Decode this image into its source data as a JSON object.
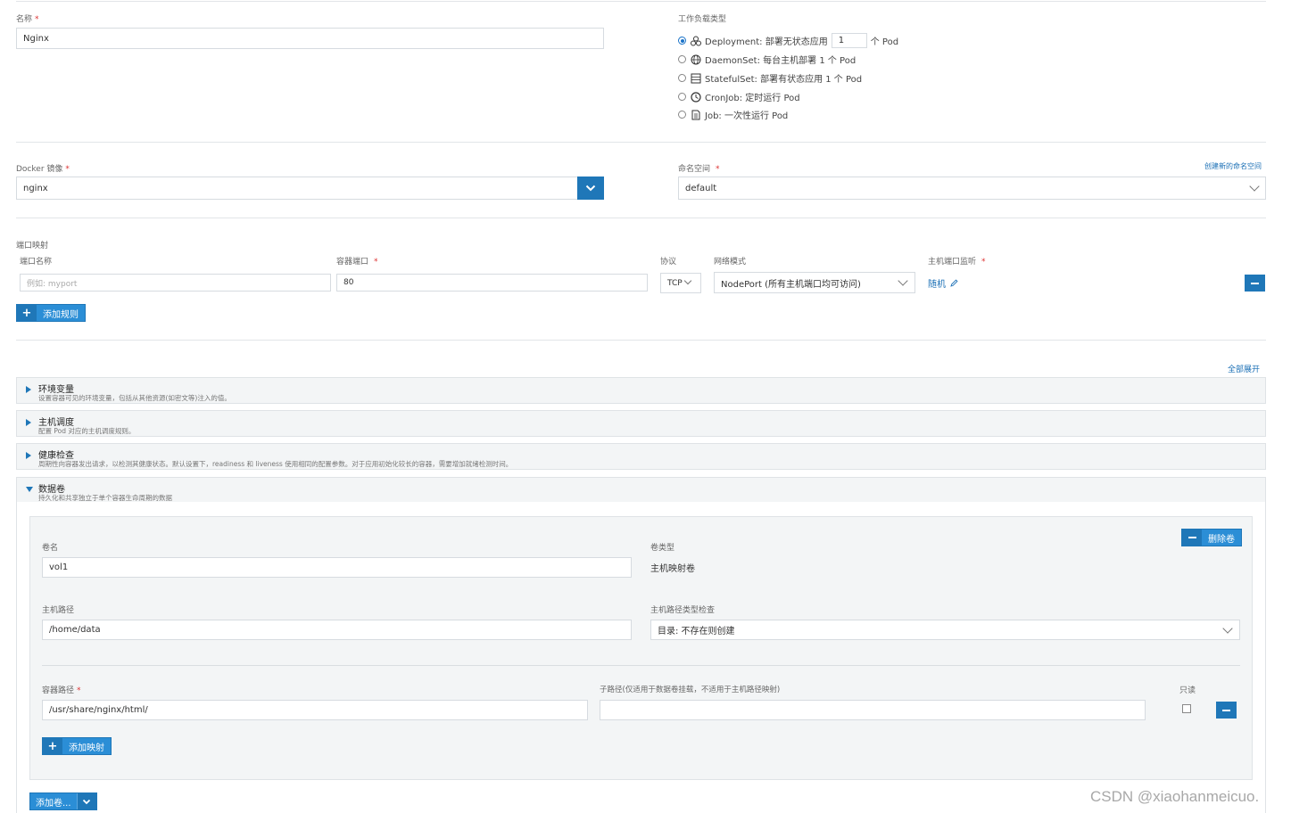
{
  "basic": {
    "name_label": "名称",
    "name_value": "Nginx",
    "workload_label": "工作负载类型",
    "workloads": [
      {
        "icon": "deployment-icon",
        "text": "Deployment: 部署无状态应用",
        "checked": true
      },
      {
        "icon": "daemonset-icon",
        "text": "DaemonSet: 每台主机部署 1 个 Pod",
        "checked": false
      },
      {
        "icon": "statefulset-icon",
        "text": "StatefulSet: 部署有状态应用 1 个 Pod",
        "checked": false
      },
      {
        "icon": "cronjob-icon",
        "text": "CronJob: 定时运行 Pod",
        "checked": false
      },
      {
        "icon": "job-icon",
        "text": "Job: 一次性运行 Pod",
        "checked": false
      }
    ],
    "replicas_value": "1",
    "replicas_suffix": "个 Pod"
  },
  "image": {
    "label": "Docker 镜像",
    "value": "nginx",
    "namespace_label": "命名空间",
    "namespace_value": "default",
    "create_namespace_link": "创建新的命名空间"
  },
  "ports": {
    "section_label": "端口映射",
    "col_name": "端口名称",
    "col_container_port": "容器端口",
    "col_protocol": "协议",
    "col_network_mode": "网络模式",
    "col_host_port": "主机端口监听",
    "name_placeholder": "例如: myport",
    "container_port_value": "80",
    "protocol_value": "TCP",
    "network_mode_value": "NodePort (所有主机端口均可访问)",
    "host_port_value": "随机",
    "add_rule_label": "添加规则"
  },
  "advanced": {
    "expand_all": "全部展开",
    "sections": [
      {
        "title": "环境变量",
        "desc": "设置容器可见的环境变量，包括从其他资源(如密文等)注入的值。"
      },
      {
        "title": "主机调度",
        "desc": "配置 Pod 对应的主机调度规则。"
      },
      {
        "title": "健康检查",
        "desc": "周期性向容器发出请求，以检测其健康状态。默认设置下，readiness 和 liveness 使用相同的配置参数。对于应用初始化较长的容器，需要增加就绪检测时间。"
      },
      {
        "title": "数据卷",
        "desc": "持久化和共享独立于单个容器生命周期的数据"
      }
    ]
  },
  "volume": {
    "remove_label": "删除卷",
    "name_label": "卷名",
    "name_value": "vol1",
    "type_label": "卷类型",
    "type_value": "主机映射卷",
    "host_path_label": "主机路径",
    "host_path_value": "/home/data",
    "host_path_check_label": "主机路径类型检查",
    "host_path_check_value": "目录: 不存在则创建",
    "mount_path_label": "容器路径",
    "mount_path_value": "/usr/share/nginx/html/",
    "sub_path_label": "子路径(仅适用于数据卷挂载，不适用于主机路径映射)",
    "sub_path_value": "",
    "readonly_label": "只读",
    "add_mount_label": "添加映射",
    "add_volume_label": "添加卷..."
  },
  "watermark": "CSDN @xiaohanmeicuo."
}
